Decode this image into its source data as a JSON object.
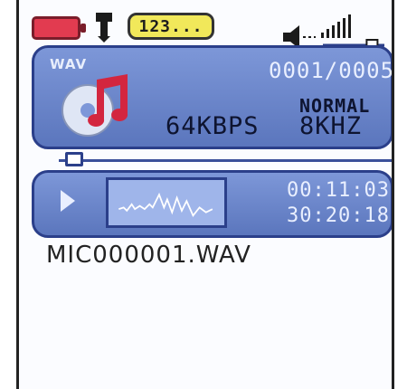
{
  "status_bar": {
    "battery_icon": "battery-icon",
    "usb_icon": "usb-plug-icon",
    "device_label": "123...",
    "volume_icon": "speaker-icon",
    "volume_level": 0.8
  },
  "info_panel": {
    "mode_label": "WAV",
    "media_icon": "music-disc-icon",
    "track_counter": "0001/0005",
    "eq_mode": "NORMAL",
    "bitrate": "64KBPS",
    "sample_rate": "8KHZ"
  },
  "progress": {
    "fraction": 0.02
  },
  "control_panel": {
    "play_icon": "play-icon",
    "waveform_icon": "waveform-icon",
    "elapsed_time": "00:11:03",
    "total_time": "30:20:18"
  },
  "file": {
    "name": "MIC000001.WAV"
  },
  "colors": {
    "panel": "#6f88cf",
    "panel_border": "#2b3f8a",
    "battery": "#e23b50",
    "badge": "#f1e85a"
  }
}
